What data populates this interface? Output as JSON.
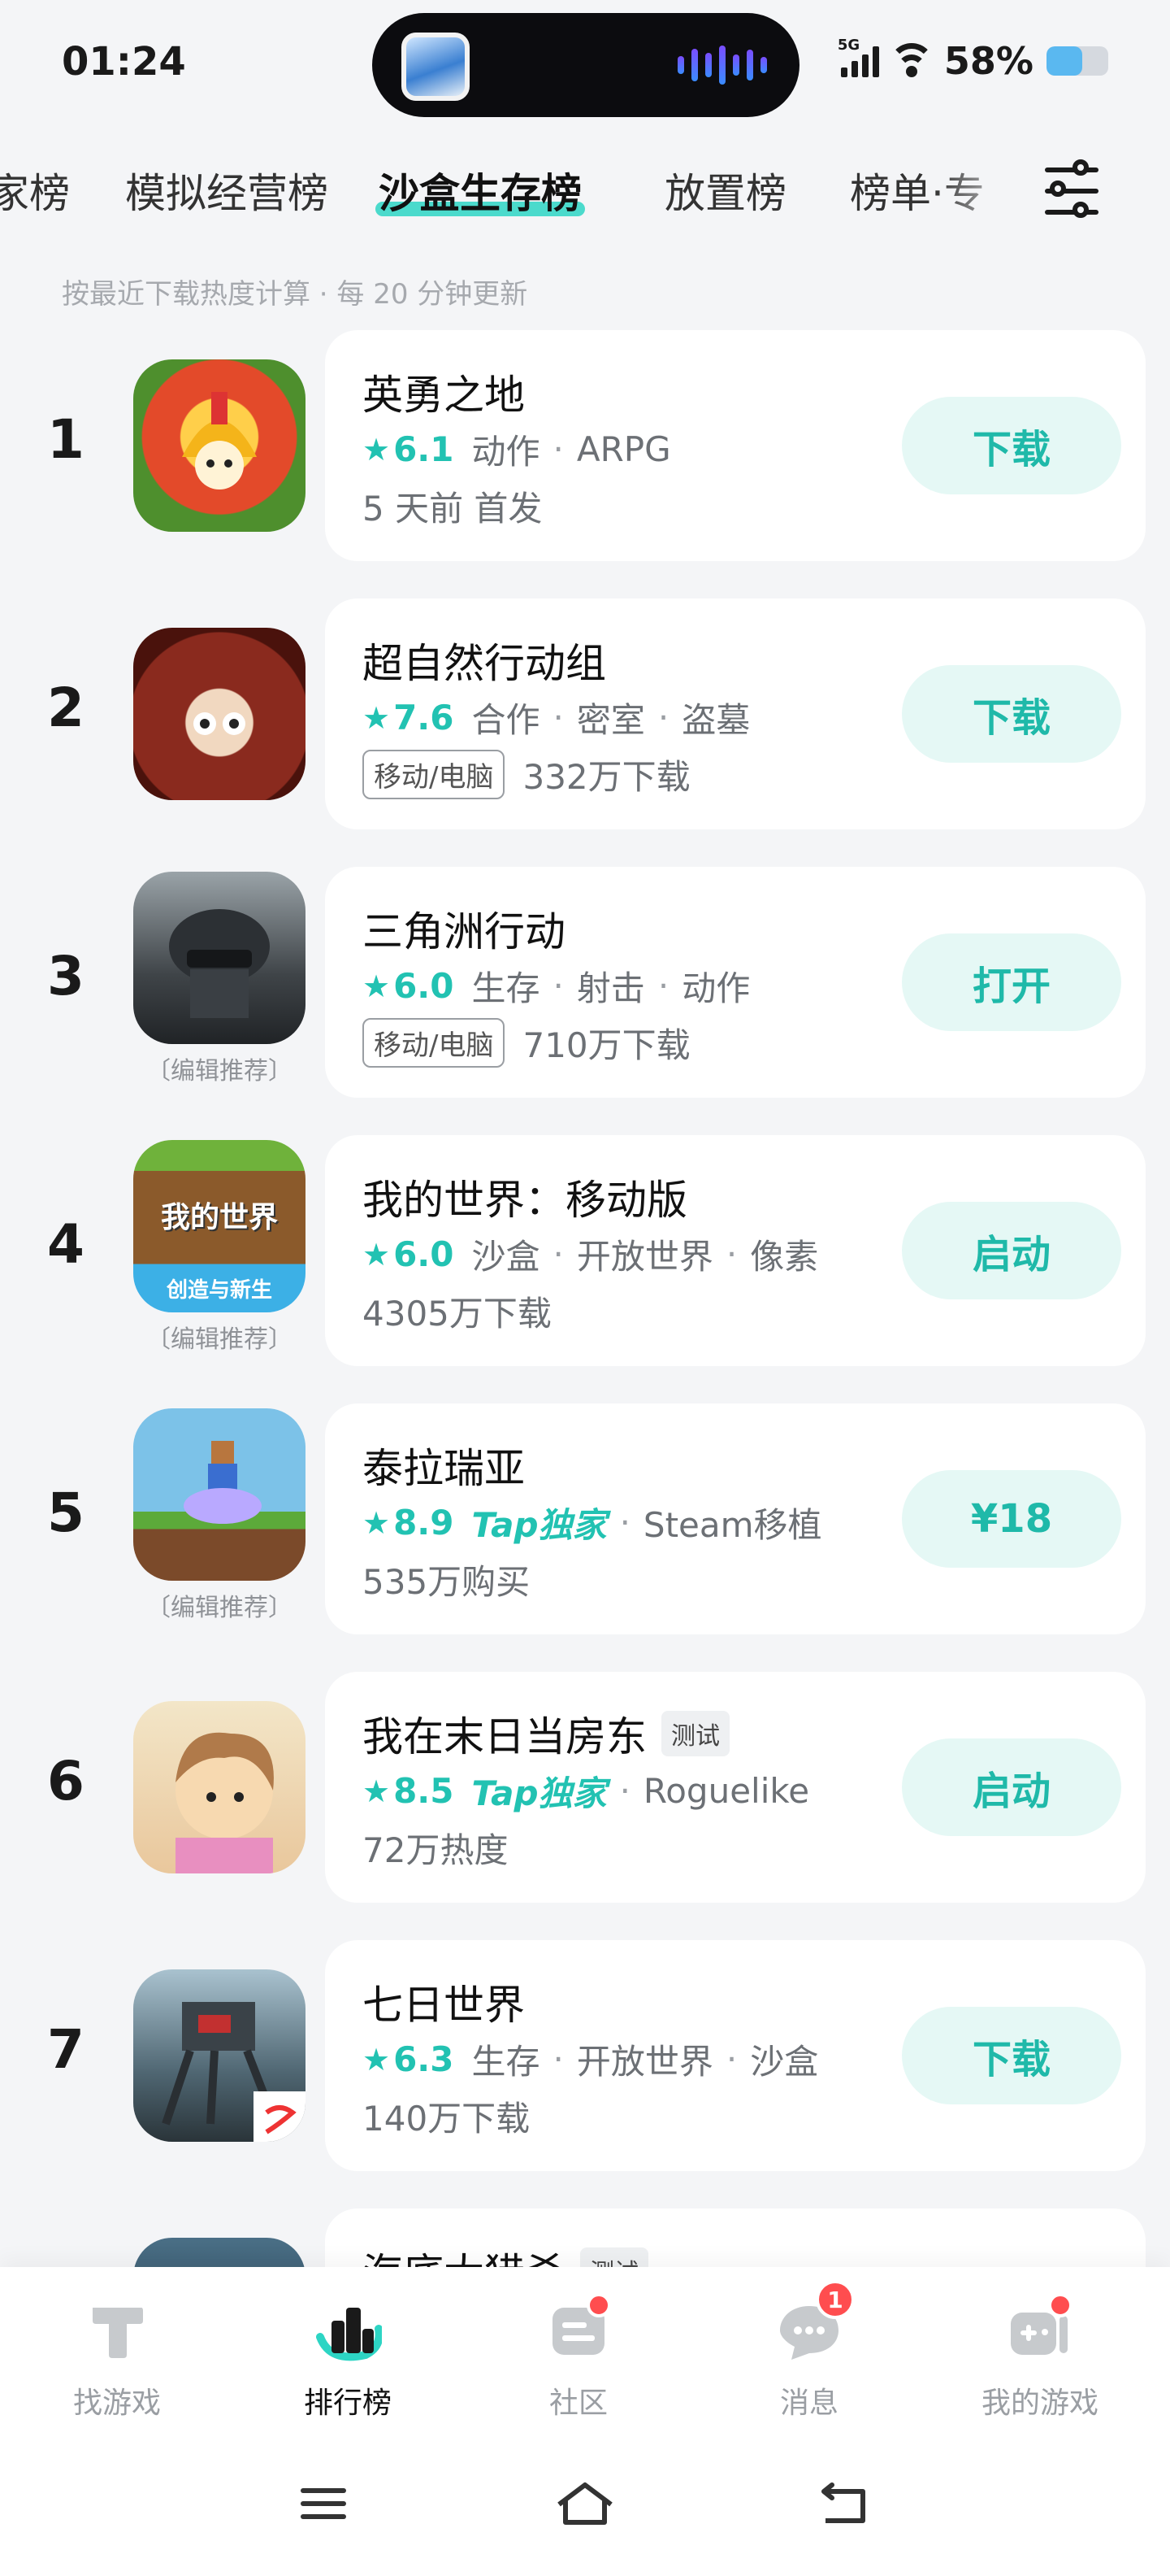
{
  "status_bar": {
    "time": "01:24",
    "network": "5G",
    "battery_pct": "58%",
    "battery_level": 0.58
  },
  "tabs": [
    "家榜",
    "模拟经营榜",
    "沙盒生存榜",
    "放置榜",
    "榜单·专"
  ],
  "active_tab": "沙盒生存榜",
  "hint": "按最近下载热度计算 · 每 20 分钟更新",
  "games": [
    {
      "rank": "1",
      "name": "英勇之地",
      "score": "6.1",
      "meta": [
        "动作",
        "ARPG"
      ],
      "sub_tag": "",
      "sub_text": "5 天前 首发",
      "action": "下载",
      "editor": "",
      "tap_exclusive": "",
      "badge": ""
    },
    {
      "rank": "2",
      "name": "超自然行动组",
      "score": "7.6",
      "meta": [
        "合作",
        "密室",
        "盗墓"
      ],
      "sub_tag": "移动/电脑",
      "sub_text": "332万下载",
      "action": "下载",
      "editor": "",
      "tap_exclusive": "",
      "badge": ""
    },
    {
      "rank": "3",
      "name": "三角洲行动",
      "score": "6.0",
      "meta": [
        "生存",
        "射击",
        "动作"
      ],
      "sub_tag": "移动/电脑",
      "sub_text": "710万下载",
      "action": "打开",
      "editor": "编辑推荐",
      "tap_exclusive": "",
      "badge": ""
    },
    {
      "rank": "4",
      "name": "我的世界：移动版",
      "score": "6.0",
      "meta": [
        "沙盒",
        "开放世界",
        "像素"
      ],
      "sub_tag": "",
      "sub_text": "4305万下载",
      "action": "启动",
      "editor": "编辑推荐",
      "tap_exclusive": "",
      "badge": "",
      "icon_text_top": "我的世界",
      "icon_text_bottom": "创造与新生"
    },
    {
      "rank": "5",
      "name": "泰拉瑞亚",
      "score": "8.9",
      "meta": [
        "Steam移植"
      ],
      "sub_tag": "",
      "sub_text": "535万购买",
      "action": "¥18",
      "editor": "编辑推荐",
      "tap_exclusive": "Tap独家",
      "badge": ""
    },
    {
      "rank": "6",
      "name": "我在末日当房东",
      "score": "8.5",
      "meta": [
        "Roguelike"
      ],
      "sub_tag": "",
      "sub_text": "72万热度",
      "action": "启动",
      "editor": "",
      "tap_exclusive": "Tap独家",
      "badge": "测试"
    },
    {
      "rank": "7",
      "name": "七日世界",
      "score": "6.3",
      "meta": [
        "生存",
        "开放世界",
        "沙盒"
      ],
      "sub_tag": "",
      "sub_text": "140万下载",
      "action": "下载",
      "editor": "",
      "tap_exclusive": "",
      "badge": ""
    },
    {
      "rank": "8",
      "name": "海底大猎杀",
      "score": "",
      "meta": [],
      "sub_tag": "",
      "sub_text": "",
      "action": "",
      "editor": "",
      "tap_exclusive": "",
      "badge": "测试"
    }
  ],
  "bottom_nav": [
    {
      "label": "找游戏",
      "icon": "find-games-icon",
      "active": false,
      "dot": false,
      "count": ""
    },
    {
      "label": "排行榜",
      "icon": "ranking-icon",
      "active": true,
      "dot": false,
      "count": ""
    },
    {
      "label": "社区",
      "icon": "community-icon",
      "active": false,
      "dot": true,
      "count": ""
    },
    {
      "label": "消息",
      "icon": "message-icon",
      "active": false,
      "dot": false,
      "count": "1"
    },
    {
      "label": "我的游戏",
      "icon": "my-games-icon",
      "active": false,
      "dot": true,
      "count": ""
    }
  ],
  "colors": {
    "accent": "#22c2b2",
    "tab_highlight": "#2dd5c4",
    "action_bg": "#e5f8f5",
    "badge_red": "#ff4d4f"
  }
}
